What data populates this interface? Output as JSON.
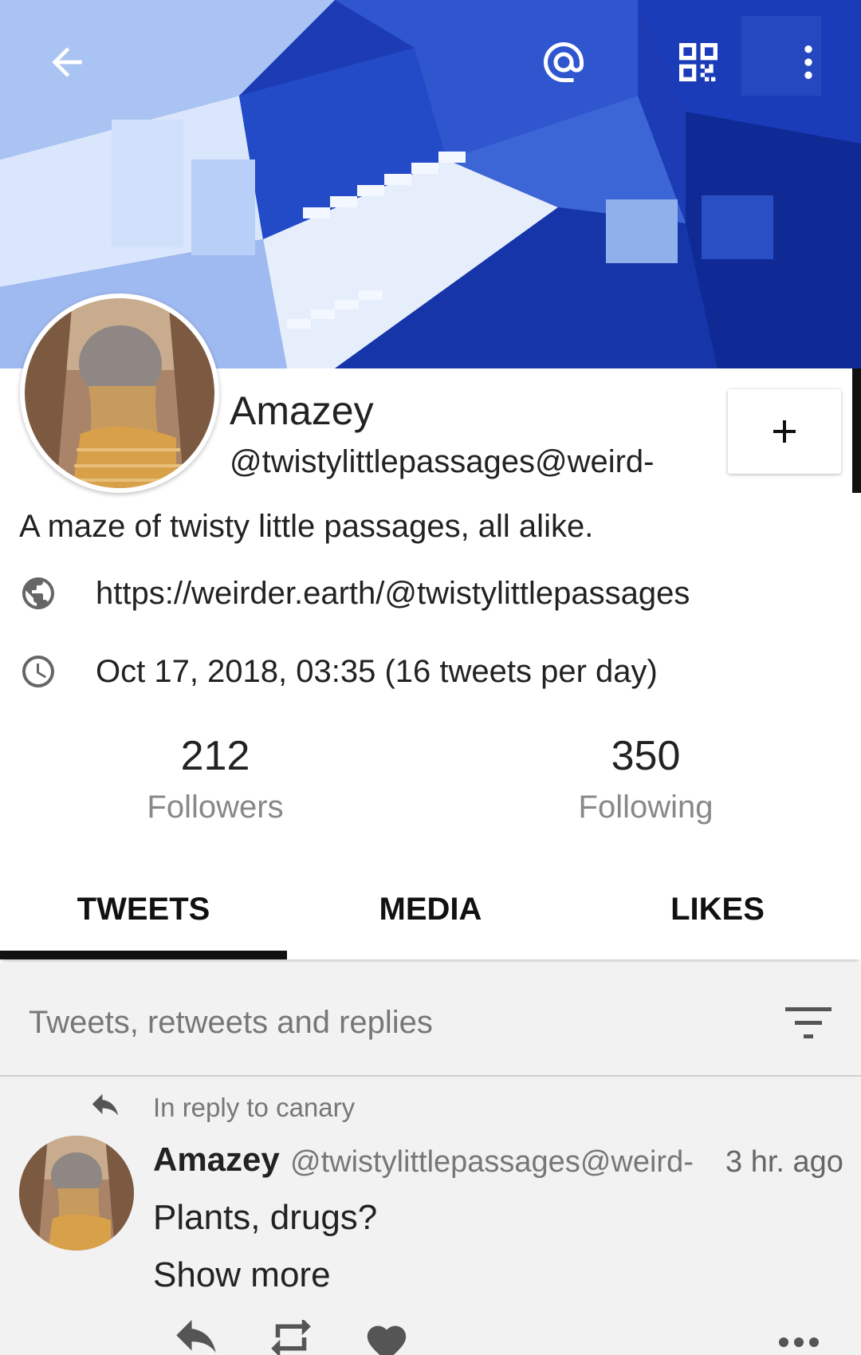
{
  "header": {
    "back_icon": "arrow-left-icon",
    "mention_icon": "at-icon",
    "qr_icon": "qr-code-icon",
    "menu_icon": "more-vert-icon"
  },
  "profile": {
    "display_name": "Amazey",
    "handle": "@twistylittlepassages@weird-",
    "bio": "A maze of twisty little passages, all alike.",
    "url": "https://weirder.earth/@twistylittlepassages",
    "joined": "Oct 17, 2018, 03:35 (16 tweets per day)",
    "follow_label": "+"
  },
  "stats": {
    "followers_count": "212",
    "followers_label": "Followers",
    "following_count": "350",
    "following_label": "Following"
  },
  "tabs": [
    {
      "label": "TWEETS",
      "active": true
    },
    {
      "label": "MEDIA",
      "active": false
    },
    {
      "label": "LIKES",
      "active": false
    }
  ],
  "filter": {
    "label": "Tweets, retweets and replies",
    "icon": "filter-icon"
  },
  "tweet": {
    "reply_to": "In reply to canary",
    "author": "Amazey",
    "handle": "@twistylittlepassages@weird-",
    "time": "3 hr. ago",
    "text": "Plants, drugs?",
    "show_more": "Show more"
  },
  "colors": {
    "banner_blue": "#1f3fb8",
    "accent_dark": "#111111",
    "muted_text": "#777777"
  }
}
